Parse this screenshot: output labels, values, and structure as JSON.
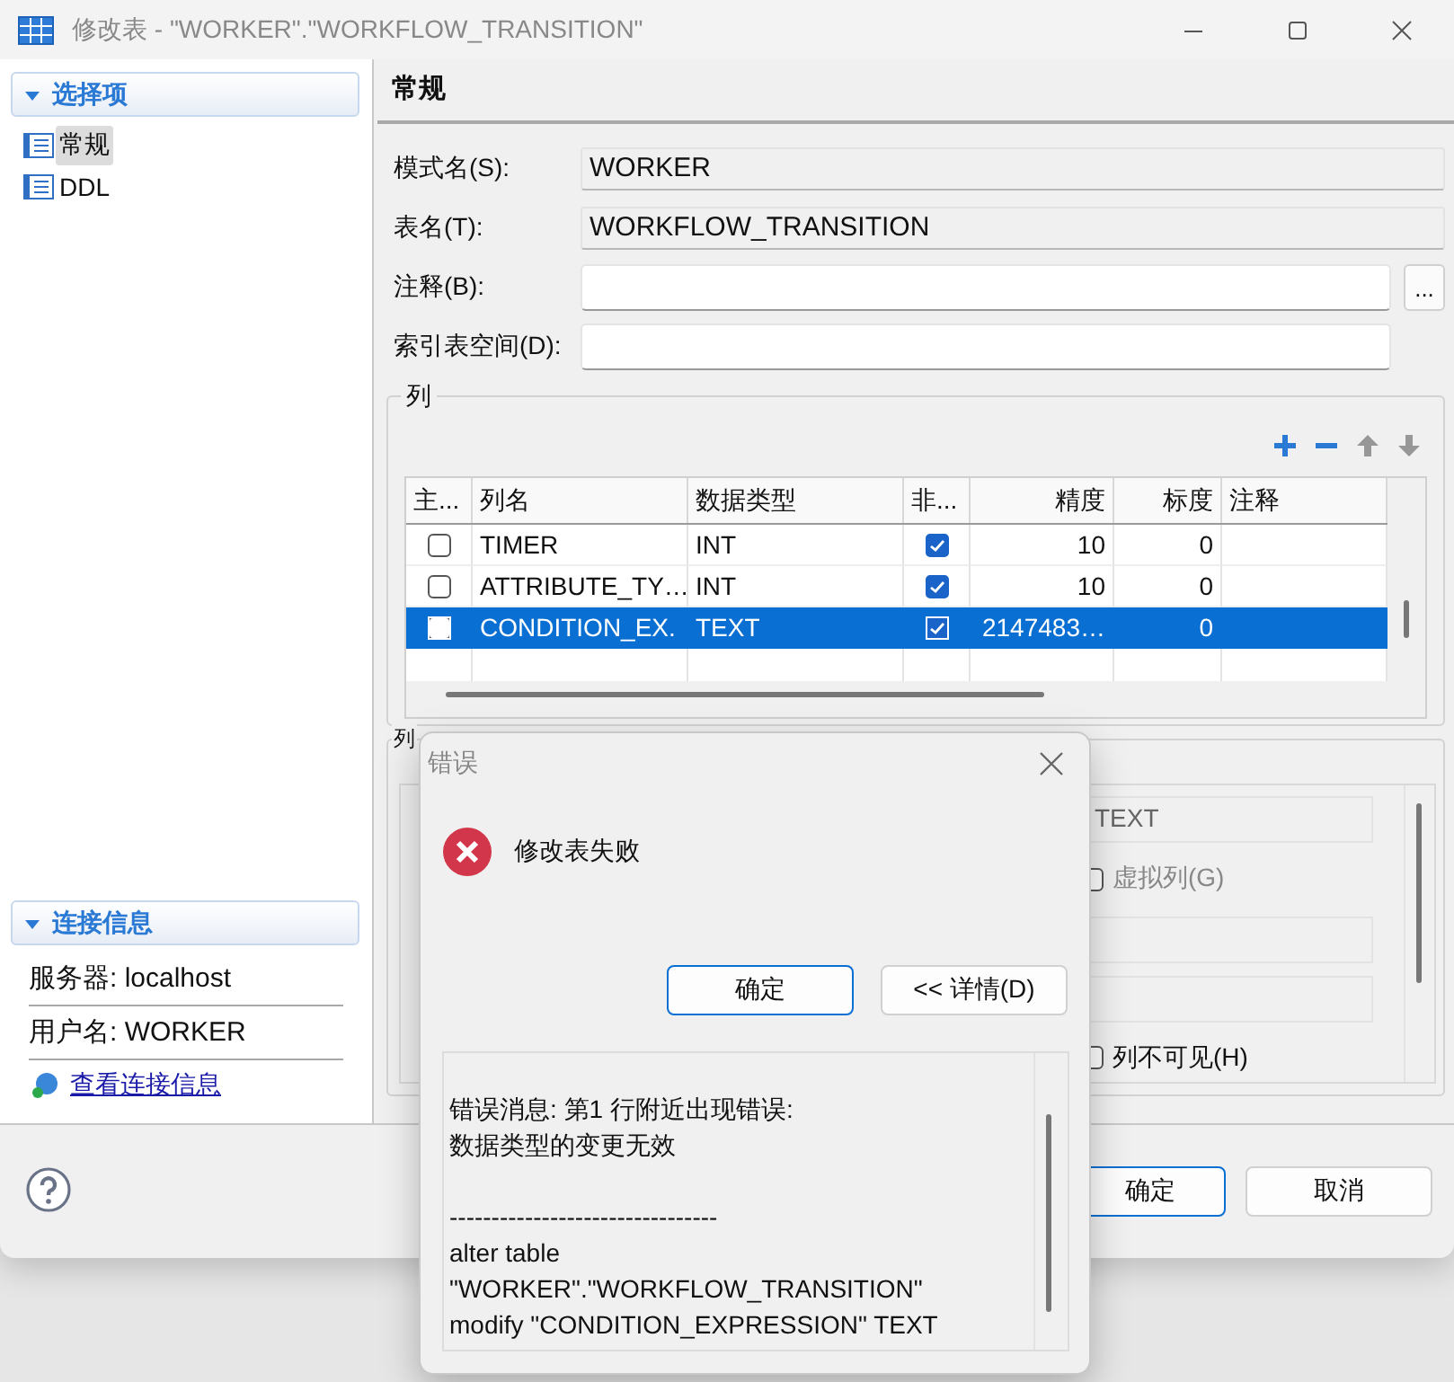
{
  "window": {
    "title": "修改表 - \"WORKER\".\"WORKFLOW_TRANSITION\""
  },
  "sidebar": {
    "selection": {
      "title": "选择项",
      "expanded": true,
      "items": [
        {
          "label": "常规",
          "selected": true
        },
        {
          "label": "DDL",
          "selected": false
        }
      ]
    },
    "connection": {
      "title": "连接信息",
      "expanded": true,
      "lines": [
        "服务器: localhost",
        "用户名: WORKER"
      ],
      "link": "查看连接信息"
    }
  },
  "panel": {
    "title": "常规",
    "fields": [
      {
        "kind": "readonly",
        "label": "模式名(S):",
        "value": "WORKER"
      },
      {
        "kind": "readonly",
        "label": "表名(T):",
        "value": "WORKFLOW_TRANSITION"
      },
      {
        "kind": "browse",
        "label": "注释(B):",
        "button": "..."
      },
      {
        "kind": "text",
        "label": "索引表空间(D):"
      }
    ]
  },
  "columns_group": {
    "title": "列",
    "toolbar": [
      {
        "kind": "add",
        "disabled": false
      },
      {
        "kind": "remove",
        "disabled": false
      },
      {
        "kind": "up",
        "disabled": true
      },
      {
        "kind": "down",
        "disabled": true
      }
    ],
    "table": {
      "columns": [
        "主...",
        "列名",
        "数据类型",
        "非...",
        "精度",
        "标度",
        "注释"
      ],
      "rows": [
        {
          "primary_key": false,
          "name": "TIMER",
          "type": "INT",
          "not_null": true,
          "precision": "10",
          "scale": "0",
          "selected": false
        },
        {
          "primary_key": false,
          "name": "ATTRIBUTE_TY…",
          "type": "INT",
          "not_null": true,
          "precision": "10",
          "scale": "0",
          "selected": false
        },
        {
          "primary_key": false,
          "name": "CONDITION_EX.",
          "type": "TEXT",
          "not_null": true,
          "precision": "2147483…",
          "scale": "0",
          "selected": true
        }
      ]
    }
  },
  "column_details": {
    "title": "列",
    "rows": [
      {
        "kind": "field",
        "value": "TEXT",
        "disabled": true
      },
      {
        "kind": "checkbox",
        "text": "虚拟列(G)",
        "checked": false,
        "disabled": true
      },
      {
        "kind": "field",
        "disabled": true
      },
      {
        "kind": "field",
        "disabled": true
      },
      {
        "kind": "checkbox",
        "text": "列不可见(H)",
        "checked": false,
        "disabled": false
      }
    ]
  },
  "footer": {
    "buttons": [
      {
        "label": "确定",
        "default": true
      },
      {
        "label": "取消",
        "default": false
      }
    ]
  },
  "error_dialog": {
    "title": "错误",
    "message": "修改表失败",
    "buttons": [
      {
        "label": "确定",
        "default": true
      },
      {
        "label": "<< 详情(D)",
        "default": false
      }
    ],
    "details": "错误消息: 第1 行附近出现错误:\n数据类型的变更无效\n\n--------------------------------\nalter table\n\"WORKER\".\"WORKFLOW_TRANSITION\"\nmodify \"CONDITION_EXPRESSION\" TEXT"
  }
}
